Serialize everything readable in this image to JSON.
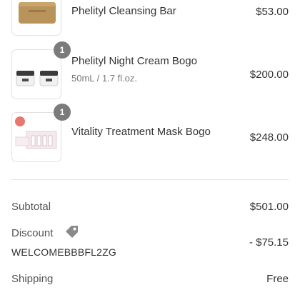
{
  "line_items": [
    {
      "name": "Phelityl Cleansing Bar",
      "variant": "",
      "price": "$53.00",
      "quantity": ""
    },
    {
      "name": "Phelityl Night Cream Bogo",
      "variant": "50mL / 1.7 fl.oz.",
      "price": "$200.00",
      "quantity": "1"
    },
    {
      "name": "Vitality Treatment Mask Bogo",
      "variant": "",
      "price": "$248.00",
      "quantity": "1"
    }
  ],
  "summary": {
    "subtotal_label": "Subtotal",
    "subtotal_value": "$501.00",
    "discount_label": "Discount",
    "discount_code": "WELCOMEBBBFL2ZG",
    "discount_value": "- $75.15",
    "shipping_label": "Shipping",
    "shipping_value": "Free"
  },
  "colors": {
    "badge": "#7b7b7b",
    "divider": "#e3e3e3",
    "soap": "#b8935a"
  },
  "icons": [
    "tag-icon"
  ]
}
